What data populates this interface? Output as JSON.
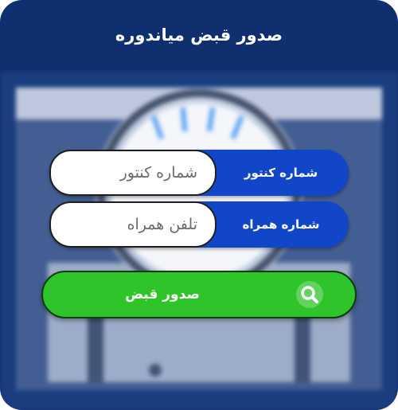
{
  "title": "صدور قبض میاندوره",
  "form": {
    "meter": {
      "label": "شماره کنتور",
      "placeholder": "شماره کنتور"
    },
    "phone": {
      "label": "شماره همراه",
      "placeholder": "تلفن همراه"
    },
    "submit_label": "صدور قبض",
    "submit_icon": "search-icon"
  },
  "colors": {
    "panel": "#0f2f6e",
    "field_label_bg": "#1246c9",
    "submit_bg": "#2ec42a",
    "text": "#ffffff"
  }
}
